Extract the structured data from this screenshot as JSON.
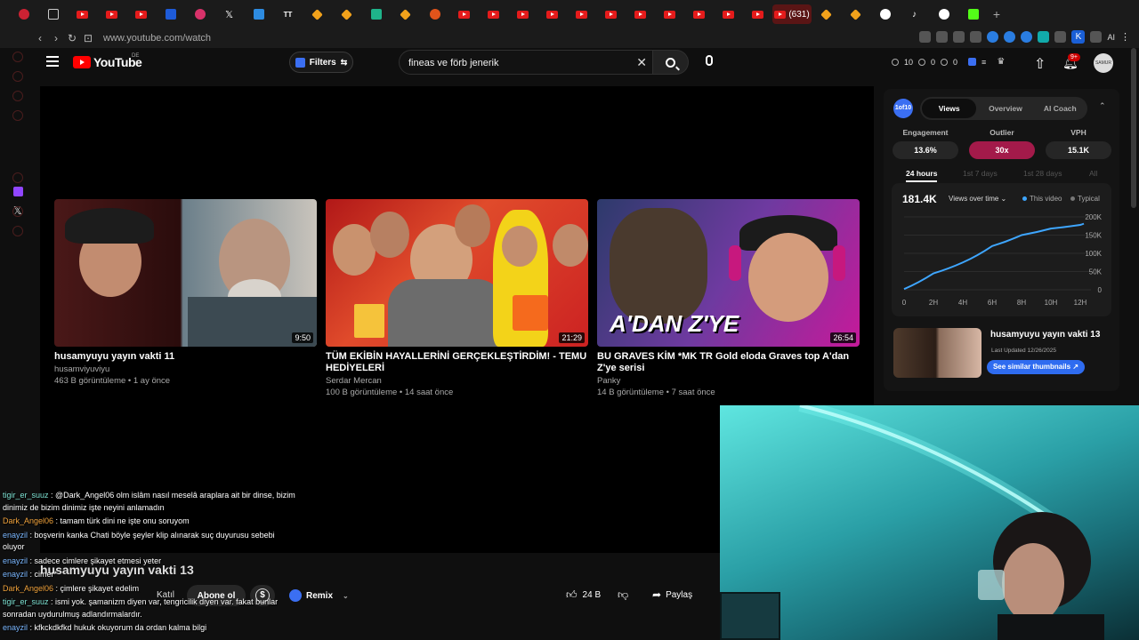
{
  "browser": {
    "tab_counter": "(631)",
    "url": "www.youtube.com/watch",
    "extension_label": "AI"
  },
  "youtube": {
    "logo_text": "YouTube",
    "region": "DE",
    "filters_label": "Filters",
    "search_query": "fineas ve förb jenerik",
    "header_stats": [
      "10",
      "0",
      "0"
    ],
    "notifications_badge": "9+",
    "avatar_text": "SAMUR"
  },
  "videos": [
    {
      "title": "husamyuyu yayın vakti 11",
      "channel": "husamviyuviyu",
      "meta": "463 B görüntüleme • 1 ay önce",
      "duration": "9:50"
    },
    {
      "title": "TÜM EKİBİN HAYALLERİNİ GERÇEKLEŞTİRDİM! - TEMU HEDİYELERİ",
      "channel": "Serdar Mercan",
      "meta": "100 B görüntüleme • 14 saat önce",
      "duration": "21:29"
    },
    {
      "title": "BU GRAVES KİM *MK TR Gold eloda Graves top A'dan Z'ye serisi",
      "channel": "Panky",
      "meta": "14 B görüntüleme • 7 saat önce",
      "duration": "26:54",
      "thumb_text": "A'DAN Z'YE"
    }
  ],
  "below_player": {
    "title": "husamyuyu yayın vakti 13",
    "join_label": "Katıl",
    "subscribe_label": "Abone ol",
    "remix_label": "Remix",
    "like_count": "24 B",
    "share_label": "Paylaş"
  },
  "chat": [
    {
      "user": "tigir_er_suuz",
      "text": " : @Dark_Angel06 olm islâm nasıl meselâ araplara ait bir dinse, bizim dinimiz de bizim dinimiz işte neyini anlamadın"
    },
    {
      "user": "Dark_Angel06",
      "text": " : tamam türk dini ne işte onu soruyom"
    },
    {
      "user": "enayzil",
      "text": " : boşverin kanka Chati böyle şeyler klip alınarak suç duyurusu sebebi oluyor"
    },
    {
      "user": "enayzil",
      "text": " : sadece cimlere şikayet etmesi yeter"
    },
    {
      "user": "enayzil",
      "text": " : cimer*"
    },
    {
      "user": "Dark_Angel06",
      "text": " : çimlere şikayet edelim"
    },
    {
      "user": "tigir_er_suuz",
      "text": " : ismi yok. şamanizm diyen var, tengricilik diyen var. fakat bunlar sonradan uydurulmuş adlandırmalardır."
    },
    {
      "user": "enayzil",
      "text": " : kfkckdkfkd hukuk okuyorum da ordan kalma bilgi"
    }
  ],
  "panel": {
    "logo_text": "1of10",
    "tabs": [
      "Views",
      "Overview",
      "AI Coach"
    ],
    "active_tab": "Views",
    "metrics": [
      {
        "label": "Engagement",
        "value": "13.6%"
      },
      {
        "label": "Outlier",
        "value": "30x"
      },
      {
        "label": "VPH",
        "value": "15.1K"
      }
    ],
    "ranges": [
      "24 hours",
      "1st 7 days",
      "1st 28 days",
      "All"
    ],
    "active_range": "24 hours",
    "total_views": "181.4K",
    "dropdown_label": "Views over time",
    "legend_this": "This video",
    "legend_typical": "Typical",
    "accent_color": "#3ea6ff",
    "similar": {
      "title": "husamyuyu yayın vakti 13",
      "updated": "Last Updated 12/26/2025",
      "button_label": "See similar thumbnails ↗"
    }
  },
  "chart_data": {
    "type": "line",
    "title": "",
    "xlabel": "",
    "ylabel": "",
    "x": [
      "0",
      "2H",
      "4H",
      "6H",
      "8H",
      "10H",
      "12H"
    ],
    "y_ticks": [
      "0",
      "50K",
      "100K",
      "150K",
      "200K"
    ],
    "ylim": [
      0,
      200000
    ],
    "series": [
      {
        "name": "This video",
        "values": [
          2000,
          45000,
          75000,
          120000,
          150000,
          168000,
          178000,
          181400
        ],
        "x_hours": [
          0,
          2,
          4,
          6,
          8,
          10,
          12,
          13
        ]
      }
    ],
    "grid": true
  }
}
